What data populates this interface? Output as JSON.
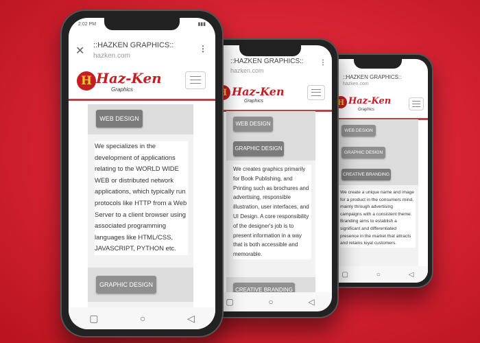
{
  "browser": {
    "page_title": "::HAZKEN GRAPHICS::",
    "url": "hazken.com",
    "time": "2:02 PM",
    "close_icon": "close-icon",
    "menu_icon": "vertical-dots-icon"
  },
  "logo": {
    "mark": "H",
    "name": "Haz-Ken",
    "tagline": "Graphics"
  },
  "buttons": {
    "web_design": "WEB DESIGN",
    "graphic_design": "GRAPHIC DESIGN",
    "creative_branding": "CREATIVE BRANDING"
  },
  "descriptions": {
    "web_design": "We specializes in the development of applications relating to the WORLD WIDE WEB or distributed network applications, which typically run protocols like HTTP from a Web Server to a client browser using associated programming languages like HTML/CSS, JAVASCRIPT, PYTHON etc.",
    "graphic_design": "We creates graphics primarily for Book Publishing, and Printing such as brochures and advertising, responsible illustration, user interfaces, and UI Design. A core responsibility of the designer's job is to present information in a way that is both accessible and memorable.",
    "creative_branding": "We create a unique name and image for a product in the consumers mind, mainly through advertising campaigns with a consistent theme. Branding aims to establish a significant and differentiated presence in the market that attracts and retains loyal customers."
  },
  "nav": {
    "square": "▢",
    "circle": "○",
    "back": "◁"
  },
  "colors": {
    "background": "#d42232",
    "brand_red": "#c41e24",
    "button_grey": "#8f8f8f"
  }
}
